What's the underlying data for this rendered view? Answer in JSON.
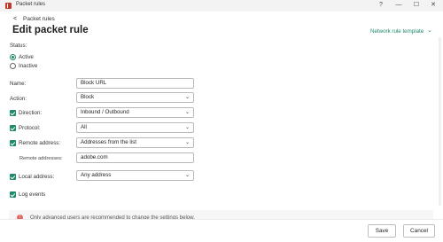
{
  "window": {
    "title": "Packet rules",
    "help_glyph": "?",
    "minimize_glyph": "—",
    "maximize_glyph": "☐",
    "close_glyph": "✕"
  },
  "header": {
    "back_glyph": "<",
    "back_label": "Packet rules",
    "page_title": "Edit packet rule",
    "template_link": "Network rule template",
    "template_chevron": "⌄"
  },
  "status": {
    "label": "Status:",
    "options": [
      {
        "label": "Active",
        "selected": true
      },
      {
        "label": "Inactive",
        "selected": false
      }
    ]
  },
  "form": {
    "name": {
      "label": "Name:",
      "value": "Block URL"
    },
    "action": {
      "label": "Action:",
      "value": "Block"
    },
    "direction": {
      "label": "Direction:",
      "value": "Inbound / Outbound",
      "checked": true
    },
    "protocol": {
      "label": "Protocol:",
      "value": "All",
      "checked": true
    },
    "remote_address": {
      "label": "Remote address:",
      "value": "Addresses from the list",
      "checked": true
    },
    "remote_addresses": {
      "label": "Remote addresses:",
      "value": "adobe.com"
    },
    "local_address": {
      "label": "Local address:",
      "value": "Any address",
      "checked": true
    },
    "log_events": {
      "label": "Log events",
      "checked": true
    },
    "dropdown_chevron": "⌄"
  },
  "warning": {
    "icon_glyph": "!",
    "text": "Only advanced users are recommended to change the settings below."
  },
  "footer": {
    "save_label": "Save",
    "cancel_label": "Cancel"
  },
  "colors": {
    "accent": "#1f8a6e",
    "brand_icon": "#c0392b"
  }
}
